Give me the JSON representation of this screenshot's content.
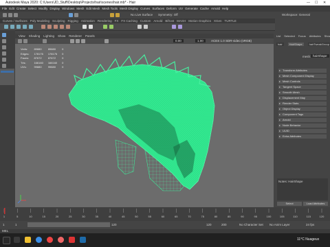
{
  "window": {
    "title": "Autodesk Maya 2020: C:\\Users\\JD_Stuff\\Desktop\\Projects\\hair\\scenes\\hair.mb* - Hair",
    "min": "—",
    "max": "☐",
    "close": "✕"
  },
  "menubar": [
    "File",
    "Edit",
    "Create",
    "Select",
    "Modify",
    "Display",
    "Windows",
    "Mesh",
    "Edit Mesh",
    "Mesh Tools",
    "Mesh Display",
    "Curves",
    "Surfaces",
    "Deform",
    "UV",
    "Generate",
    "Cache",
    "Arnold",
    "Help"
  ],
  "status": {
    "surface": "No Live Surface",
    "symmetry": "Symmetry: Off",
    "workspace": "Workspace: General"
  },
  "shelf_tabs": [
    "Curves / Surfaces",
    "Poly Modeling",
    "Sculpting",
    "Rigging",
    "Animation",
    "Rendering",
    "FX",
    "FX Caching",
    "Custom",
    "Arnold",
    "Bifrost",
    "MASH",
    "Motion Graphics",
    "XGen",
    "TURTLE"
  ],
  "viewport_menu": [
    "View",
    "Shading",
    "Lighting",
    "Show",
    "Renderer",
    "Panels"
  ],
  "viewport_fields": {
    "val1": "0.00",
    "val2": "1.00",
    "colorspace": "ACES 1.0 SDR-video (sRGB)"
  },
  "hud": {
    "rows": [
      [
        "Verts:",
        "89880",
        "89880",
        "0"
      ],
      [
        "Edges:",
        "178176",
        "178176",
        "0"
      ],
      [
        "Faces:",
        "87672",
        "87672",
        "0"
      ],
      [
        "Tris:",
        "166160",
        "166160",
        "0"
      ],
      [
        "UVs:",
        "99880",
        "99880",
        "0"
      ]
    ]
  },
  "right_panel": {
    "tabs": [
      "List",
      "Selected",
      "Focus",
      "Attributes",
      "Show",
      "Help"
    ],
    "node_tabs": [
      "hair",
      "HairShape",
      "hairTweakGroup"
    ],
    "node_label": "mesh:",
    "node_value": "hairShape",
    "sections": [
      "Transform Attributes",
      "Mesh Component Display",
      "Mesh Controls",
      "Tangent Space",
      "Smooth Mesh",
      "Displacement Map",
      "Render Stats",
      "Object Display",
      "Component Tags",
      "Arnold",
      "Node Behavior",
      "UUID",
      "Extra Attributes"
    ],
    "notes_label": "Notes: HairShape",
    "select_btn": "Select",
    "load_btn": "Load Attributes",
    "copy_btn": "Copy Tab"
  },
  "timeline": {
    "ticks": [
      "1",
      "5",
      "10",
      "15",
      "20",
      "25",
      "30",
      "35",
      "40",
      "45",
      "50",
      "55",
      "60",
      "65",
      "70",
      "75",
      "80",
      "85",
      "90",
      "95",
      "100",
      "105",
      "110",
      "115",
      "120"
    ],
    "start": "1",
    "range_start": "1",
    "range_end": "120",
    "end": "120",
    "anim_end": "200",
    "fps": "24 fps",
    "character_set": "No Character Set",
    "anim_layer": "No Anim Layer"
  },
  "command_line": {
    "mode": "MEL"
  },
  "taskbar": {
    "weather": "11°C  Nuageux"
  },
  "colors": {
    "mesh": "#2fe08a",
    "viewport": "#6c6c6c",
    "timeline_marker": "#c33"
  }
}
